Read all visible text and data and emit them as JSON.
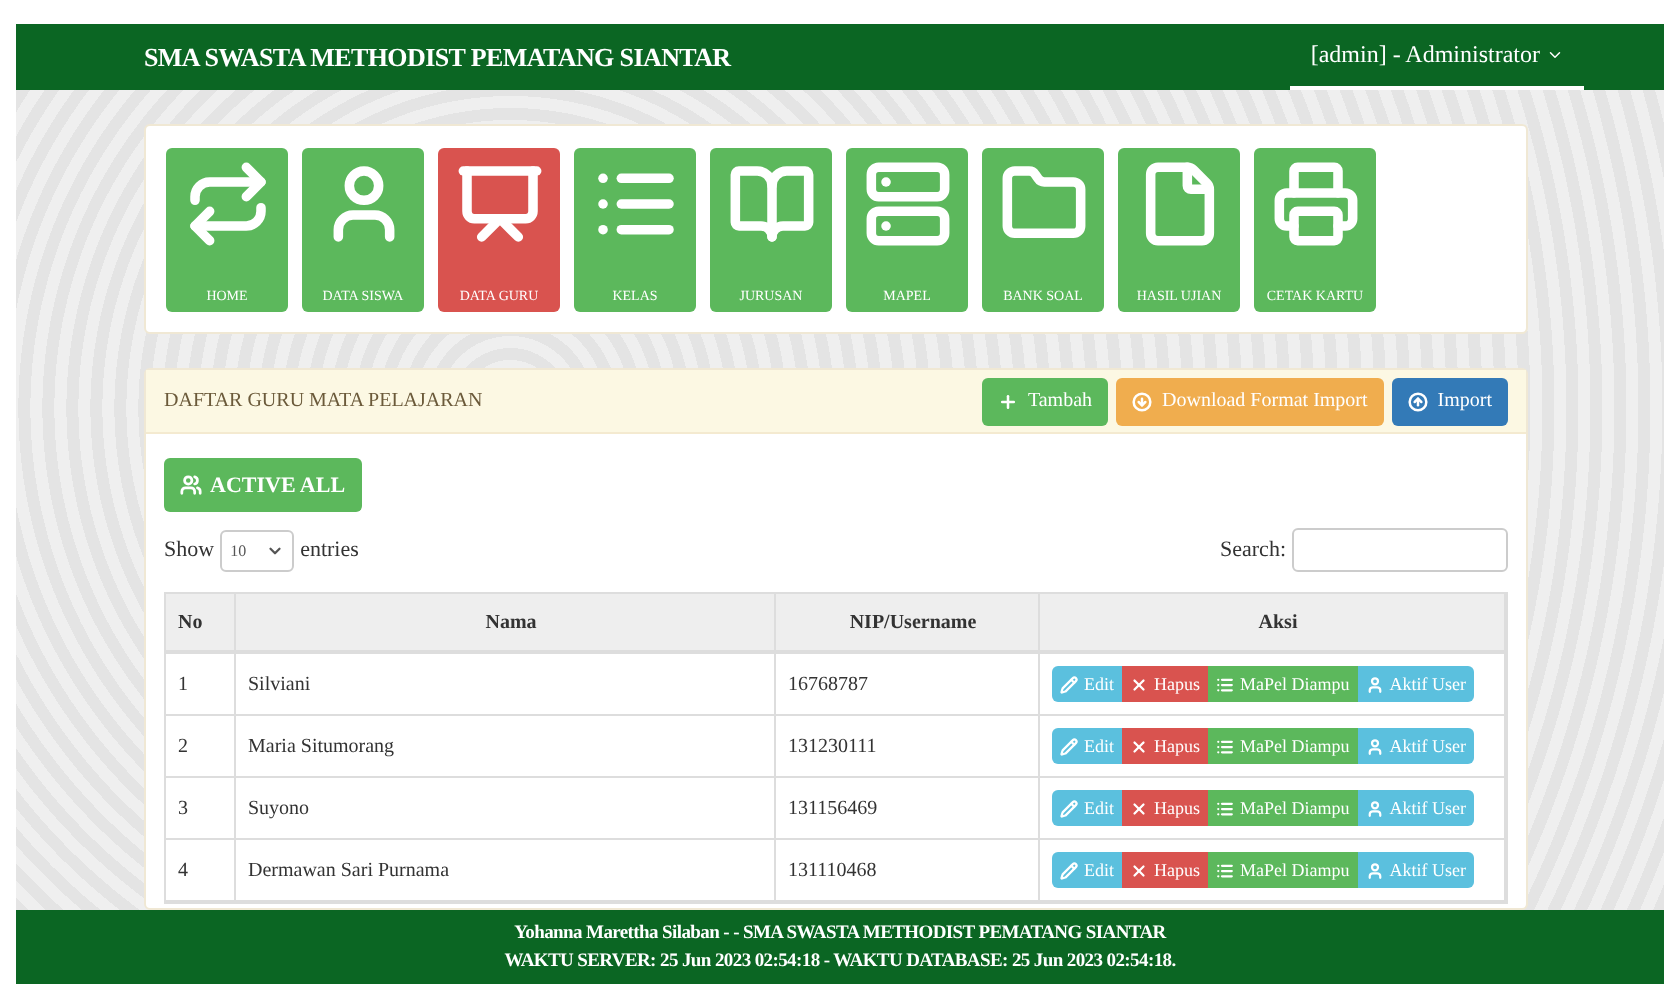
{
  "navbar": {
    "brand": "SMA SWASTA METHODIST PEMATANG SIANTAR",
    "user_menu": "[admin] - Administrator"
  },
  "menu": [
    {
      "label": "HOME",
      "kind": "home",
      "selected": false
    },
    {
      "label": "DATA SISWA",
      "kind": "user",
      "selected": false
    },
    {
      "label": "DATA GURU",
      "kind": "teacher",
      "selected": true
    },
    {
      "label": "KELAS",
      "kind": "list",
      "selected": false
    },
    {
      "label": "JURUSAN",
      "kind": "book",
      "selected": false
    },
    {
      "label": "MAPEL",
      "kind": "server",
      "selected": false
    },
    {
      "label": "BANK SOAL",
      "kind": "folder",
      "selected": false
    },
    {
      "label": "HASIL UJIAN",
      "kind": "file",
      "selected": false
    },
    {
      "label": "CETAK KARTU",
      "kind": "print",
      "selected": false
    }
  ],
  "panel": {
    "title": "DAFTAR GURU MATA PELAJARAN",
    "buttons": [
      {
        "label": "Tambah",
        "kind": "add"
      },
      {
        "label": "Download Format Import",
        "kind": "download"
      },
      {
        "label": "Import",
        "kind": "import"
      }
    ],
    "active_all": "ACTIVE ALL",
    "show_label": "Show",
    "entries_value": "10",
    "entries_label": "entries",
    "search_label": "Search:"
  },
  "table": {
    "columns": [
      "No",
      "Nama",
      "NIP/Username",
      "Aksi"
    ],
    "rows": [
      {
        "no": "1",
        "nama": "Silviani",
        "nip": "16768787",
        "actions": [
          {
            "label": "Edit",
            "kind": "edit"
          },
          {
            "label": "Hapus",
            "kind": "delete"
          },
          {
            "label": "MaPel Diampu",
            "kind": "subjects"
          },
          {
            "label": "Aktif User",
            "kind": "user"
          }
        ]
      },
      {
        "no": "2",
        "nama": "Maria Situmorang",
        "nip": "131230111",
        "actions": [
          {
            "label": "Edit",
            "kind": "edit"
          },
          {
            "label": "Hapus",
            "kind": "delete"
          },
          {
            "label": "MaPel Diampu",
            "kind": "subjects"
          },
          {
            "label": "Aktif User",
            "kind": "user"
          }
        ]
      },
      {
        "no": "3",
        "nama": "Suyono",
        "nip": "131156469",
        "actions": [
          {
            "label": "Edit",
            "kind": "edit"
          },
          {
            "label": "Hapus",
            "kind": "delete"
          },
          {
            "label": "MaPel Diampu",
            "kind": "subjects"
          },
          {
            "label": "Aktif User",
            "kind": "user"
          }
        ]
      },
      {
        "no": "4",
        "nama": "Dermawan Sari Purnama",
        "nip": "131110468",
        "actions": [
          {
            "label": "Edit",
            "kind": "edit"
          },
          {
            "label": "Hapus",
            "kind": "delete"
          },
          {
            "label": "MaPel Diampu",
            "kind": "subjects"
          },
          {
            "label": "Aktif User",
            "kind": "user"
          }
        ]
      }
    ]
  },
  "footer": {
    "line_1": "Yohanna Marettha Silaban - - SMA SWASTA METHODIST PEMATANG SIANTAR",
    "line_2": "WAKTU SERVER: 25 Jun 2023 02:54:18 - WAKTU DATABASE: 25 Jun 2023 02:54:18."
  }
}
